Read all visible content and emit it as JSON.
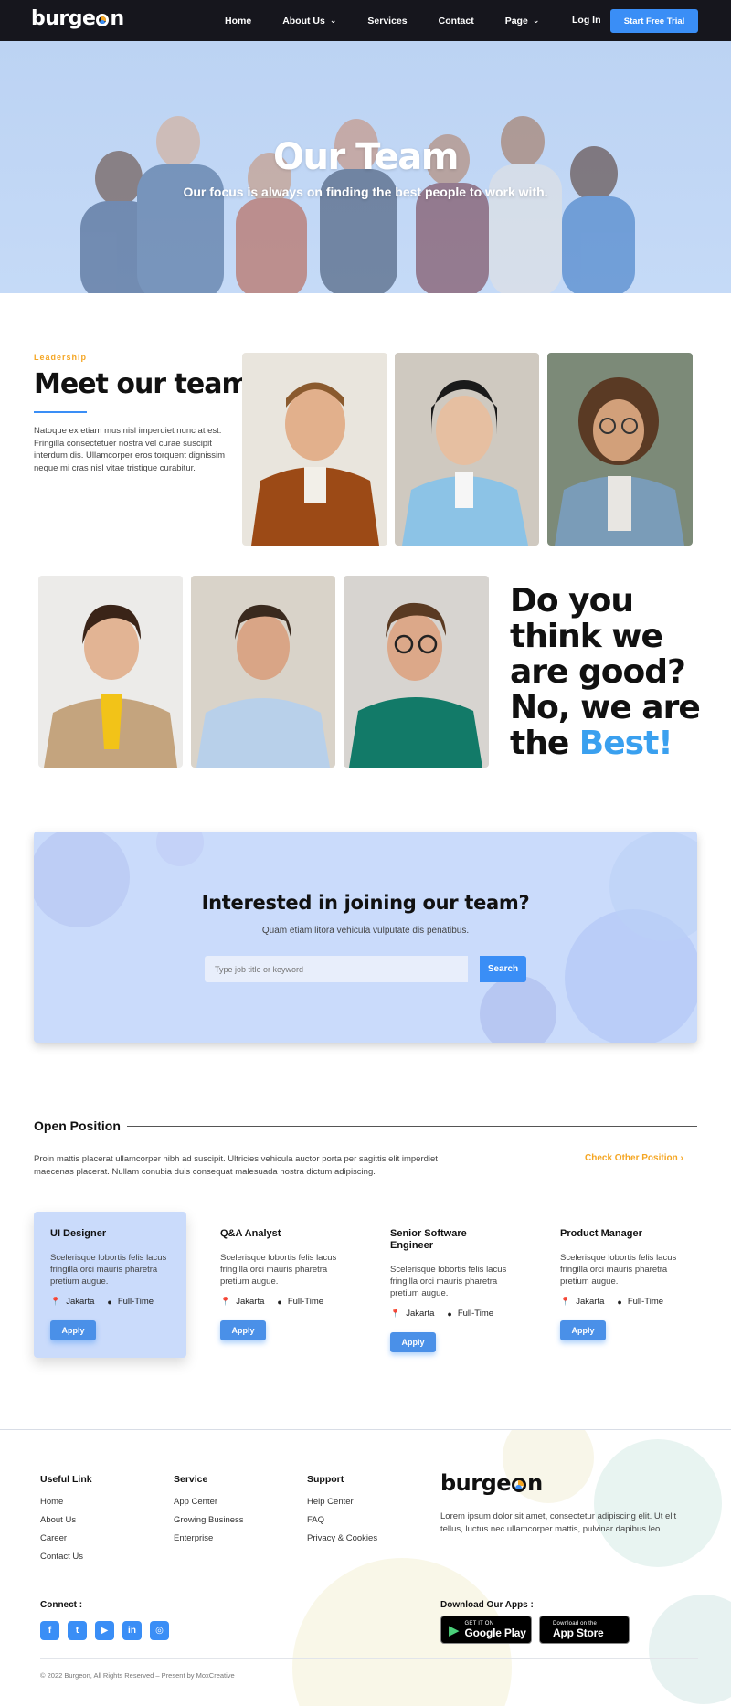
{
  "nav": {
    "logo": "burgeon",
    "links": [
      {
        "label": "Home",
        "has_dropdown": false
      },
      {
        "label": "About Us",
        "has_dropdown": true
      },
      {
        "label": "Services",
        "has_dropdown": false
      },
      {
        "label": "Contact",
        "has_dropdown": false
      },
      {
        "label": "Page",
        "has_dropdown": true
      }
    ],
    "login": "Log In",
    "cta": "Start Free Trial"
  },
  "hero": {
    "title": "Our Team",
    "subtitle": "Our focus is always on finding the best people to work with."
  },
  "leadership": {
    "eyebrow": "Leadership",
    "heading": "Meet our team",
    "text": "Natoque ex etiam mus nisl imperdiet nunc at est. Fringilla consectetuer nostra vel curae suscipit interdum dis. Ullamcorper eros torquent dignissim neque mi cras nisl vitae tristique curabitur."
  },
  "tagline": {
    "line1": "Do you",
    "line2": "think we",
    "line3": "are good?",
    "line4": "No, we are",
    "line5_prefix": "the ",
    "line5_highlight": "Best!"
  },
  "join": {
    "title": "Interested in joining our team?",
    "subtitle": "Quam etiam litora vehicula vulputate dis penatibus.",
    "search_placeholder": "Type job title or keyword",
    "search_button": "Search"
  },
  "open_position": {
    "title": "Open Position",
    "text": "Proin mattis placerat ullamcorper nibh ad suscipit. Ultricies vehicula auctor porta per sagittis elit imperdiet maecenas placerat. Nullam conubia duis consequat malesuada nostra dictum adipiscing.",
    "check_link": "Check Other Position",
    "jobs": [
      {
        "title": "UI Designer",
        "desc": "Scelerisque lobortis felis lacus fringilla orci mauris pharetra pretium augue.",
        "location": "Jakarta",
        "type": "Full-Time",
        "apply": "Apply",
        "active": true
      },
      {
        "title": "Q&A Analyst",
        "desc": "Scelerisque lobortis felis lacus fringilla orci mauris pharetra pretium augue.",
        "location": "Jakarta",
        "type": "Full-Time",
        "apply": "Apply",
        "active": false
      },
      {
        "title": "Senior Software Engineer",
        "desc": "Scelerisque lobortis felis lacus fringilla orci mauris pharetra pretium augue.",
        "location": "Jakarta",
        "type": "Full-Time",
        "apply": "Apply",
        "active": false
      },
      {
        "title": "Product Manager",
        "desc": "Scelerisque lobortis felis lacus fringilla orci mauris pharetra pretium augue.",
        "location": "Jakarta",
        "type": "Full-Time",
        "apply": "Apply",
        "active": false
      }
    ]
  },
  "footer": {
    "useful_link": {
      "heading": "Useful Link",
      "items": [
        "Home",
        "About Us",
        "Career",
        "Contact Us"
      ]
    },
    "service": {
      "heading": "Service",
      "items": [
        "App Center",
        "Growing Business",
        "Enterprise"
      ]
    },
    "support": {
      "heading": "Support",
      "items": [
        "Help Center",
        "FAQ",
        "Privacy & Cookies"
      ]
    },
    "logo": "burgeon",
    "description": "Lorem ipsum dolor sit amet, consectetur adipiscing elit. Ut elit tellus, luctus nec ullamcorper mattis, pulvinar dapibus leo.",
    "connect_label": "Connect :",
    "social_icons": [
      "facebook-icon",
      "twitter-icon",
      "youtube-icon",
      "linkedin-icon",
      "instagram-icon"
    ],
    "download_label": "Download Our Apps :",
    "google_play": {
      "small": "GET IT ON",
      "big": "Google Play"
    },
    "app_store": {
      "small": "Download on the",
      "big": "App Store"
    },
    "copyright": "© 2022 Burgeon, All Rights Reserved – Present by MoxCreative"
  },
  "colors": {
    "accent": "#3a8ef6",
    "orange": "#f5a623",
    "dark": "#16161d",
    "light_blue": "#cadbfb"
  }
}
